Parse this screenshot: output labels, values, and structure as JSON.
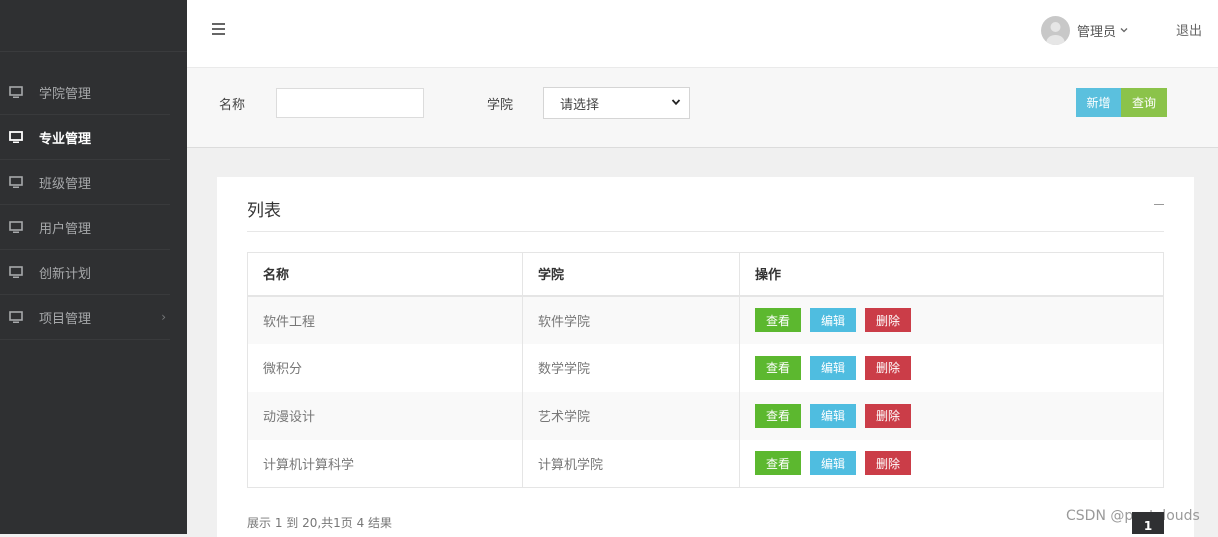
{
  "sidebar": {
    "items": [
      {
        "label": "学院管理",
        "icon": "monitor-icon",
        "active": false
      },
      {
        "label": "专业管理",
        "icon": "monitor-icon",
        "active": true
      },
      {
        "label": "班级管理",
        "icon": "monitor-icon",
        "active": false
      },
      {
        "label": "用户管理",
        "icon": "monitor-icon",
        "active": false
      },
      {
        "label": "创新计划",
        "icon": "monitor-icon",
        "active": false
      },
      {
        "label": "项目管理",
        "icon": "monitor-icon",
        "active": false,
        "submenu_icon": "chevron-right-icon"
      }
    ],
    "chevron": "›"
  },
  "header": {
    "menu_icon": "hamburger-icon",
    "user_name": "管理员",
    "user_dropdown_icon": "chevron-down-icon",
    "logout_label": "退出"
  },
  "filter": {
    "name_label": "名称",
    "name_value": "",
    "college_label": "学院",
    "college_selected": "请选择",
    "add_label": "新增",
    "query_label": "查询"
  },
  "panel": {
    "title": "列表",
    "collapse_icon": "minus-icon"
  },
  "table": {
    "headers": [
      "名称",
      "学院",
      "操作"
    ],
    "rows": [
      {
        "name": "软件工程",
        "college": "软件学院"
      },
      {
        "name": "微积分",
        "college": "数学学院"
      },
      {
        "name": "动漫设计",
        "college": "艺术学院"
      },
      {
        "name": "计算机计算科学",
        "college": "计算机学院"
      }
    ],
    "actions": {
      "view": "查看",
      "edit": "编辑",
      "delete": "删除"
    }
  },
  "pagination": {
    "info": "展示 1 到 20,共1页 4 结果",
    "current_page": "1"
  },
  "watermark": "CSDN @pastclouds",
  "colors": {
    "sidebar_bg": "#2f3032",
    "add_button": "#5bc0de",
    "query_button": "#8bc34a",
    "view_button": "#5cb82f",
    "edit_button": "#4fbde0",
    "delete_button": "#cb3d48"
  }
}
